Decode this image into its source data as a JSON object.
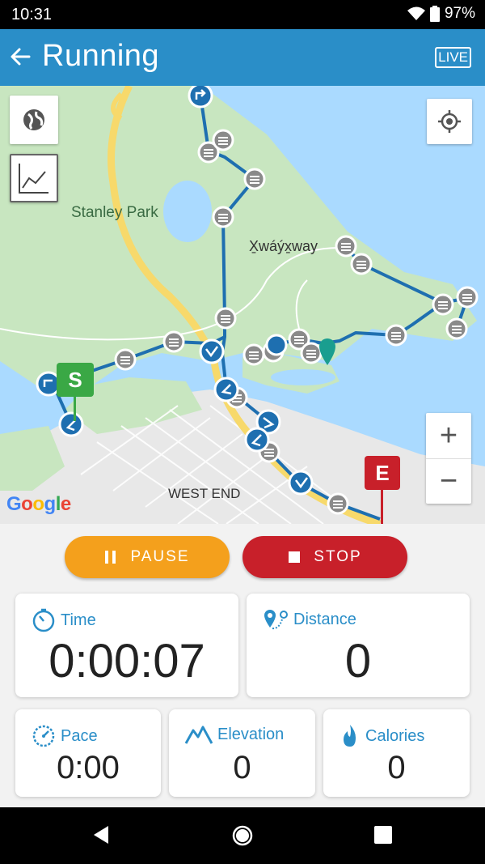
{
  "status_bar": {
    "time": "10:31",
    "battery": "97%"
  },
  "app_bar": {
    "title": "Running",
    "live_badge": "LIVE"
  },
  "map": {
    "labels": {
      "park": "Stanley Park",
      "place": "X̱wáýx̱way",
      "district": "WEST END"
    },
    "start_marker": "S",
    "end_marker": "E",
    "attribution": "Google",
    "zoom_in": "+",
    "zoom_out": "−"
  },
  "buttons": {
    "pause": "PAUSE",
    "stop": "STOP"
  },
  "stats": {
    "time": {
      "label": "Time",
      "value": "0:00:07"
    },
    "distance": {
      "label": "Distance",
      "value": "0"
    },
    "pace": {
      "label": "Pace",
      "value": "0:00"
    },
    "elevation": {
      "label": "Elevation",
      "value": "0"
    },
    "calories": {
      "label": "Calories",
      "value": "0"
    }
  },
  "colors": {
    "app_bar": "#2a8ec8",
    "pause": "#f4a01c",
    "stop": "#c8202a",
    "route": "#1e6fb0",
    "start": "#3aa845",
    "end": "#c8202a"
  }
}
